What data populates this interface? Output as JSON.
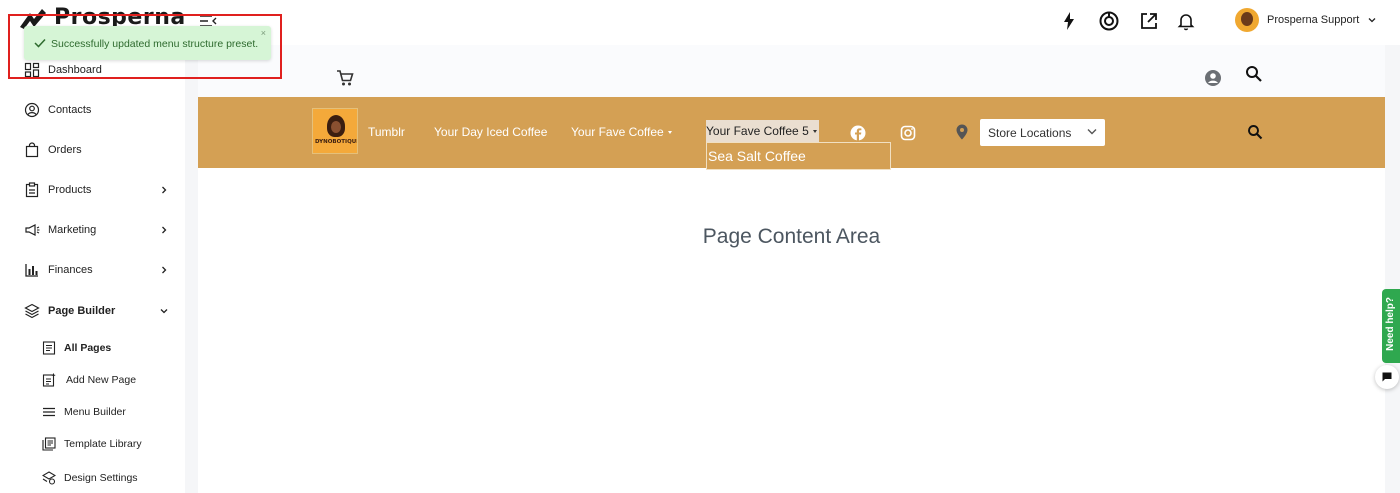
{
  "app": {
    "brand": "Prosperna"
  },
  "header": {
    "user_name": "Prosperna Support",
    "icons": [
      "bolt-icon",
      "target-icon",
      "external-link-icon",
      "bell-icon"
    ]
  },
  "toast": {
    "message": "Successfully updated menu structure preset.",
    "close_label": "×",
    "color": "#d6f5d6",
    "highlight_color": "#e0201e"
  },
  "sidebar": {
    "items": [
      {
        "label": "Dashboard",
        "icon": "grid-icon"
      },
      {
        "label": "Contacts",
        "icon": "user-circle-icon"
      },
      {
        "label": "Orders",
        "icon": "shopping-bag-icon"
      },
      {
        "label": "Products",
        "icon": "clipboard-icon"
      },
      {
        "label": "Marketing",
        "icon": "megaphone-icon"
      },
      {
        "label": "Finances",
        "icon": "bar-chart-icon"
      },
      {
        "label": "Page Builder",
        "icon": "layers-icon"
      }
    ],
    "sub_items": [
      {
        "label": "All Pages",
        "icon": "page-icon"
      },
      {
        "label": "Add New Page",
        "icon": "add-page-icon"
      },
      {
        "label": "Menu Builder",
        "icon": "menu-icon"
      },
      {
        "label": "Template Library",
        "icon": "library-icon"
      },
      {
        "label": "Design Settings",
        "icon": "design-icon"
      }
    ]
  },
  "preview": {
    "brand_logo_text": "DYNOBOTIQUE",
    "nav": {
      "links": [
        "Tumblr",
        "Your Day Iced Coffee",
        "Your Fave Coffee"
      ],
      "open_item": "Your Fave Coffee 5",
      "dropdown_items": [
        "Sea Salt Coffee"
      ],
      "store_select": "Store Locations"
    },
    "content_text": "Page Content Area",
    "nav_color": "#d4a054"
  },
  "help": {
    "label": "Need help?"
  }
}
